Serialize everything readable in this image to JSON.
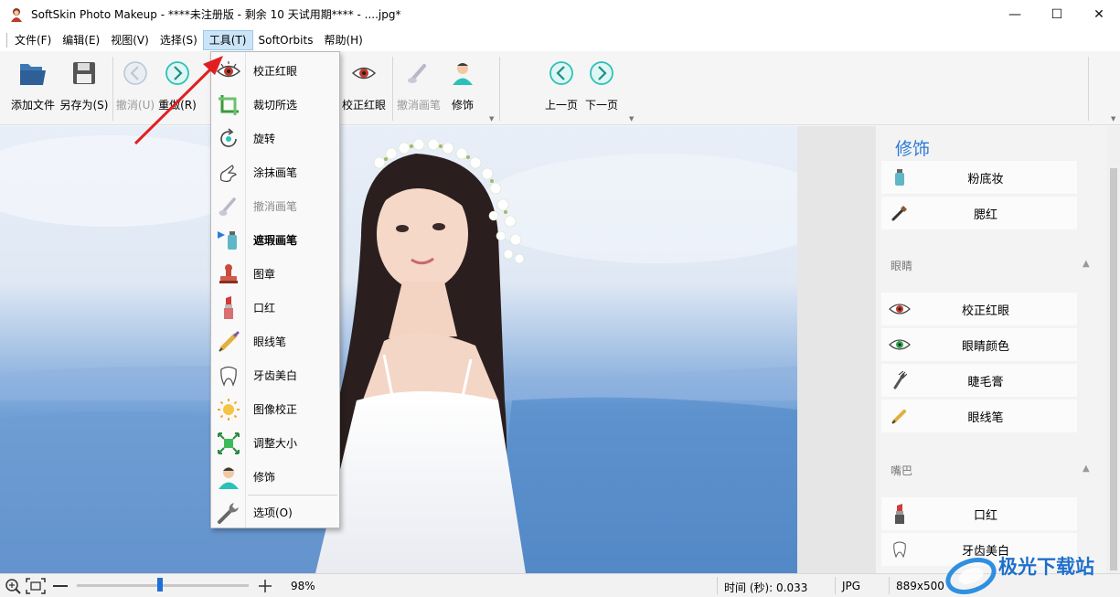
{
  "window": {
    "title": "SoftSkin Photo Makeup - ****未注册版 - 剩余 10 天试用期**** - ....jpg*",
    "minimize": "—",
    "maximize": "☐",
    "close": "✕"
  },
  "menubar": {
    "items": [
      "文件(F)",
      "编辑(E)",
      "视图(V)",
      "选择(S)",
      "工具(T)",
      "SoftOrbits",
      "帮助(H)"
    ],
    "active_index": 4
  },
  "toolbar": {
    "add_file": "添加文件",
    "save_as": "另存为(S)",
    "undo": "撤消(U)",
    "redo": "重做(R)",
    "redeye": "校正红眼",
    "undo_brush": "撤消画笔",
    "retouch": "修饰",
    "prev_page": "上一页",
    "next_page": "下一页"
  },
  "tools_menu": {
    "items": [
      {
        "label": "校正红眼",
        "icon": "red-eye-icon",
        "state": "normal"
      },
      {
        "label": "裁切所选",
        "icon": "crop-icon",
        "state": "normal"
      },
      {
        "label": "旋转",
        "icon": "rotate-icon",
        "state": "normal"
      },
      {
        "label": "涂抹画笔",
        "icon": "smudge-brush-icon",
        "state": "normal"
      },
      {
        "label": "撤消画笔",
        "icon": "undo-brush-icon",
        "state": "disabled"
      },
      {
        "label": "遮瑕画笔",
        "icon": "concealer-brush-icon",
        "state": "bold"
      },
      {
        "label": "图章",
        "icon": "stamp-icon",
        "state": "normal"
      },
      {
        "label": "口红",
        "icon": "lipstick-icon",
        "state": "normal"
      },
      {
        "label": "眼线笔",
        "icon": "eyeliner-icon",
        "state": "normal"
      },
      {
        "label": "牙齿美白",
        "icon": "tooth-icon",
        "state": "normal"
      },
      {
        "label": "图像校正",
        "icon": "image-correction-icon",
        "state": "normal"
      },
      {
        "label": "调整大小",
        "icon": "resize-icon",
        "state": "normal"
      },
      {
        "label": "修饰",
        "icon": "retouch-person-icon",
        "state": "normal"
      }
    ],
    "options": {
      "label": "选项(O)",
      "icon": "wrench-icon"
    }
  },
  "right_panel": {
    "title": "修饰",
    "makeup_items": [
      {
        "label": "粉底妆",
        "icon": "foundation-icon"
      },
      {
        "label": "腮红",
        "icon": "blush-brush-icon"
      }
    ],
    "eyes_section": "眼睛",
    "eyes_items": [
      {
        "label": "校正红眼",
        "icon": "red-eye-icon"
      },
      {
        "label": "眼睛颜色",
        "icon": "eye-color-icon"
      },
      {
        "label": "睫毛膏",
        "icon": "mascara-icon"
      },
      {
        "label": "眼线笔",
        "icon": "eyeliner-icon"
      }
    ],
    "mouth_section": "嘴巴",
    "mouth_items": [
      {
        "label": "口红",
        "icon": "lipstick-icon"
      },
      {
        "label": "牙齿美白",
        "icon": "tooth-icon"
      }
    ]
  },
  "statusbar": {
    "zoom": "98%",
    "zoom_level": 0.47,
    "time": "时间 (秒): 0.033",
    "format": "JPG",
    "dimensions": "889x500"
  },
  "watermark": {
    "text": "极光下载站"
  },
  "colors": {
    "accent_blue": "#2b7bd6",
    "menu_highlight": "#cce4f7",
    "arrow_red": "#e02020",
    "nav_teal": "#2cc1b7"
  }
}
